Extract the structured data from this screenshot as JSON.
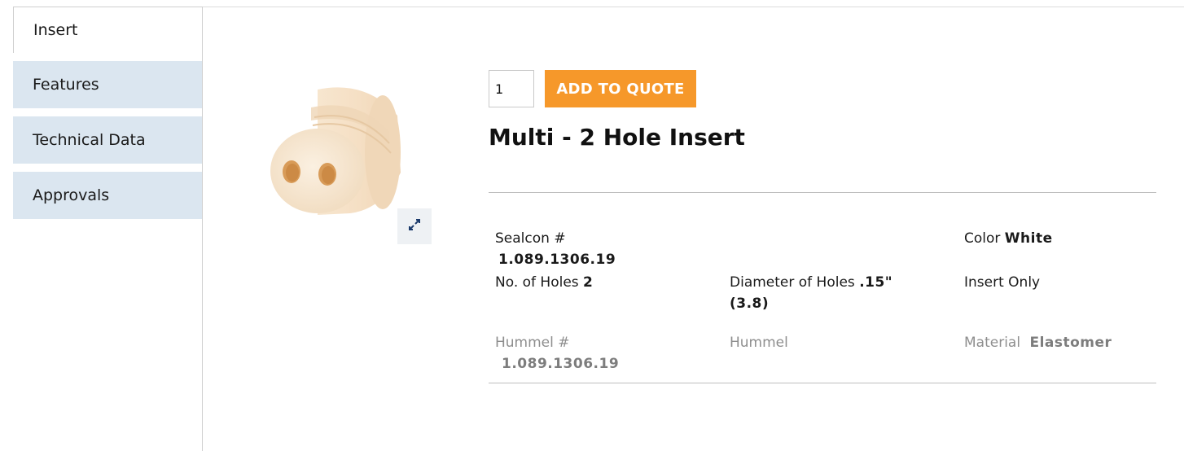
{
  "tabs": [
    {
      "label": "Insert",
      "active": true
    },
    {
      "label": "Features",
      "active": false
    },
    {
      "label": "Technical Data",
      "active": false
    },
    {
      "label": "Approvals",
      "active": false
    }
  ],
  "product": {
    "quantity": "1",
    "add_to_quote_label": "ADD TO QUOTE",
    "title": "Multi - 2 Hole Insert",
    "expand_icon": "expand-arrows-icon",
    "image": "cream-colored cylindrical 2-hole insert"
  },
  "specs": {
    "sealcon_label": "Sealcon #",
    "sealcon_value": "1.089.1306.19",
    "color_label": "Color",
    "color_value": "White",
    "holes_label": "No. of Holes",
    "holes_value": "2",
    "diameter_label": "Diameter of Holes",
    "diameter_value": ".15\" (3.8)",
    "insert_only": "Insert Only",
    "hummel_label": "Hummel #",
    "hummel_value": "1.089.1306.19",
    "hummel_col2": "Hummel",
    "material_label": "Material",
    "material_value": "Elastomer"
  },
  "colors": {
    "accent": "#f6982a",
    "tab_inactive_bg": "#dbe6f0",
    "product": "#f6e3cc"
  }
}
